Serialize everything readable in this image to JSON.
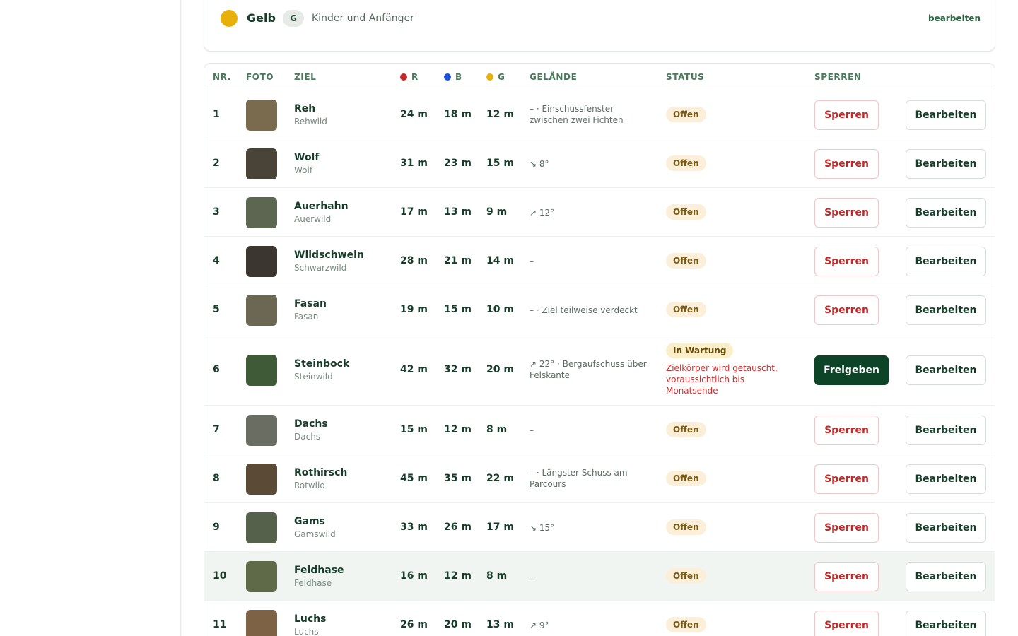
{
  "color_card": {
    "name": "Gelb",
    "letter": "G",
    "description": "Kinder und Anfänger",
    "edit_label": "bearbeiten",
    "dot_color": "#e8b10a"
  },
  "table": {
    "headers": {
      "nr": "NR.",
      "foto": "FOTO",
      "ziel": "ZIEL",
      "r": "R",
      "b": "B",
      "g": "G",
      "gelaende": "GELÄNDE",
      "status": "STATUS",
      "sperren": "SPERREN"
    },
    "header_dot_colors": {
      "r": "#c62828",
      "b": "#1e4fd8",
      "g": "#e8b10a"
    },
    "rows": [
      {
        "nr": "1",
        "name": "Reh",
        "sub": "Rehwild",
        "r": "24 m",
        "b": "18 m",
        "g": "12 m",
        "terrain": "– · Einschussfenster zwischen zwei Fichten",
        "status": "Offen",
        "note": "",
        "action": "Sperren",
        "edit": "Bearbeiten",
        "photo_color": "#7a6a4e"
      },
      {
        "nr": "2",
        "name": "Wolf",
        "sub": "Wolf",
        "r": "31 m",
        "b": "23 m",
        "g": "15 m",
        "terrain": "↘ 8°",
        "status": "Offen",
        "note": "",
        "action": "Sperren",
        "edit": "Bearbeiten",
        "photo_color": "#4a4438"
      },
      {
        "nr": "3",
        "name": "Auerhahn",
        "sub": "Auerwild",
        "r": "17 m",
        "b": "13 m",
        "g": "9 m",
        "terrain": "↗ 12°",
        "status": "Offen",
        "note": "",
        "action": "Sperren",
        "edit": "Bearbeiten",
        "photo_color": "#5c6650"
      },
      {
        "nr": "4",
        "name": "Wildschwein",
        "sub": "Schwarzwild",
        "r": "28 m",
        "b": "21 m",
        "g": "14 m",
        "terrain": "–",
        "status": "Offen",
        "note": "",
        "action": "Sperren",
        "edit": "Bearbeiten",
        "photo_color": "#3b3630"
      },
      {
        "nr": "5",
        "name": "Fasan",
        "sub": "Fasan",
        "r": "19 m",
        "b": "15 m",
        "g": "10 m",
        "terrain": "– · Ziel teilweise verdeckt",
        "status": "Offen",
        "note": "",
        "action": "Sperren",
        "edit": "Bearbeiten",
        "photo_color": "#6b6752"
      },
      {
        "nr": "6",
        "name": "Steinbock",
        "sub": "Steinwild",
        "r": "42 m",
        "b": "32 m",
        "g": "20 m",
        "terrain": "↗ 22° · Bergaufschuss über Felskante",
        "status": "In Wartung",
        "note": "Zielkörper wird getauscht, voraussichtlich bis Monatsende",
        "action": "Freigeben",
        "edit": "Bearbeiten",
        "photo_color": "#3f5a36"
      },
      {
        "nr": "7",
        "name": "Dachs",
        "sub": "Dachs",
        "r": "15 m",
        "b": "12 m",
        "g": "8 m",
        "terrain": "–",
        "status": "Offen",
        "note": "",
        "action": "Sperren",
        "edit": "Bearbeiten",
        "photo_color": "#6a6e62"
      },
      {
        "nr": "8",
        "name": "Rothirsch",
        "sub": "Rotwild",
        "r": "45 m",
        "b": "35 m",
        "g": "22 m",
        "terrain": "– · Längster Schuss am Parcours",
        "status": "Offen",
        "note": "",
        "action": "Sperren",
        "edit": "Bearbeiten",
        "photo_color": "#5a4a36"
      },
      {
        "nr": "9",
        "name": "Gams",
        "sub": "Gamswild",
        "r": "33 m",
        "b": "26 m",
        "g": "17 m",
        "terrain": "↘ 15°",
        "status": "Offen",
        "note": "",
        "action": "Sperren",
        "edit": "Bearbeiten",
        "photo_color": "#56614c"
      },
      {
        "nr": "10",
        "name": "Feldhase",
        "sub": "Feldhase",
        "r": "16 m",
        "b": "12 m",
        "g": "8 m",
        "terrain": "–",
        "status": "Offen",
        "note": "",
        "action": "Sperren",
        "edit": "Bearbeiten",
        "photo_color": "#5f6a48"
      },
      {
        "nr": "11",
        "name": "Luchs",
        "sub": "Luchs",
        "r": "26 m",
        "b": "20 m",
        "g": "13 m",
        "terrain": "↗ 9°",
        "status": "Offen",
        "note": "",
        "action": "Sperren",
        "edit": "Bearbeiten",
        "photo_color": "#7d6246"
      }
    ]
  }
}
